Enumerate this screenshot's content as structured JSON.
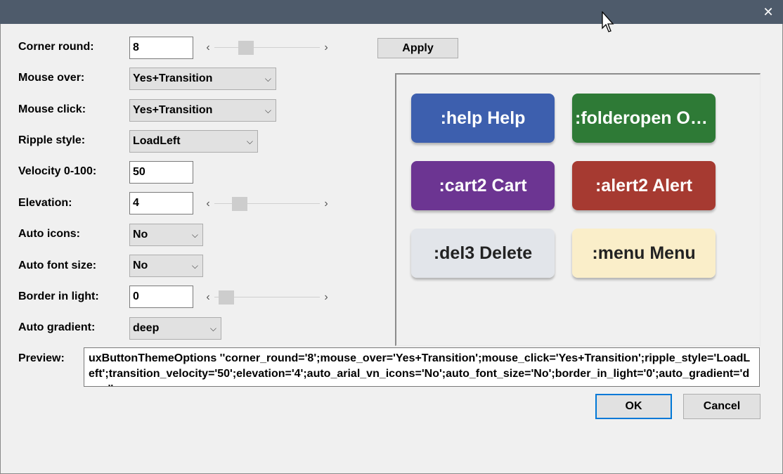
{
  "window": {
    "close_glyph": "✕"
  },
  "form": {
    "corner_round": {
      "label": "Corner round:",
      "value": "8",
      "slider": 0.22
    },
    "mouse_over": {
      "label": "Mouse over:",
      "value": "Yes+Transition"
    },
    "mouse_click": {
      "label": "Mouse click:",
      "value": "Yes+Transition"
    },
    "ripple_style": {
      "label": "Ripple style:",
      "value": "LoadLeft"
    },
    "velocity": {
      "label": "Velocity 0-100:",
      "value": "50"
    },
    "elevation": {
      "label": "Elevation:",
      "value": "4",
      "slider": 0.15
    },
    "auto_icons": {
      "label": "Auto icons:",
      "value": "No"
    },
    "auto_font_size": {
      "label": "Auto font size:",
      "value": "No"
    },
    "border_in_light": {
      "label": "Border in light:",
      "value": "0",
      "slider": 0.0
    },
    "auto_gradient": {
      "label": "Auto gradient:",
      "value": "deep"
    },
    "preview_label": "Preview:",
    "preview_text": "uxButtonThemeOptions ''corner_round='8';mouse_over='Yes+Transition';mouse_click='Yes+Transition';ripple_style='LoadLeft';transition_velocity='50';elevation='4';auto_arial_vn_icons='No';auto_font_size='No';border_in_light='0';auto_gradient='deep''"
  },
  "buttons": {
    "apply": "Apply",
    "ok": "OK",
    "cancel": "Cancel"
  },
  "arrows": {
    "left": "‹",
    "right": "›",
    "down": "⌵"
  },
  "theme_buttons": [
    {
      "label": ":help Help",
      "color": "#3d5fae",
      "text": "#ffffff"
    },
    {
      "label": ":folderopen Open",
      "color": "#2e7a36",
      "text": "#ffffff"
    },
    {
      "label": ":cart2 Cart",
      "color": "#6c3592",
      "text": "#ffffff"
    },
    {
      "label": ":alert2 Alert",
      "color": "#a63a31",
      "text": "#ffffff"
    },
    {
      "label": ":del3 Delete",
      "color": "#e2e5ea",
      "text": "#222222"
    },
    {
      "label": ":menu Menu",
      "color": "#faeec9",
      "text": "#222222"
    }
  ]
}
